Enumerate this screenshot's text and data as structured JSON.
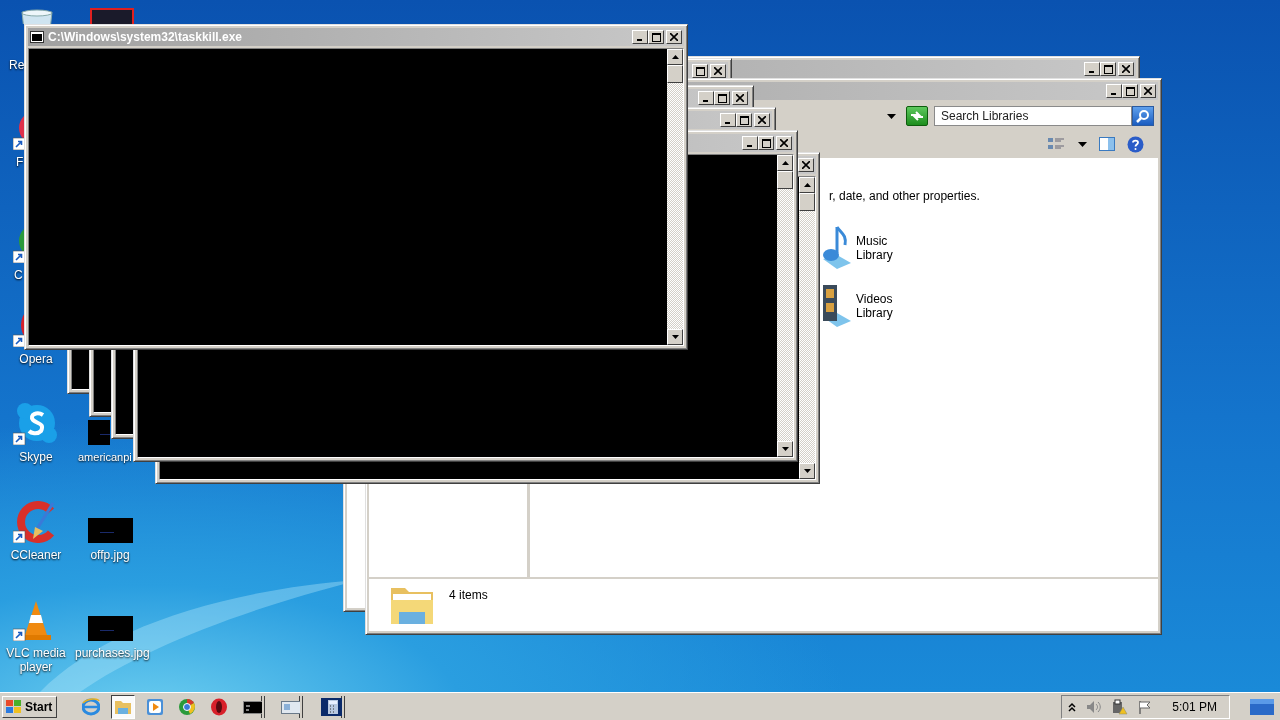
{
  "desktop_icons": [
    {
      "kind": "recycle-bin",
      "label": "Re",
      "shortcut": false
    },
    {
      "kind": "red-orb",
      "label": "F",
      "shortcut": true
    },
    {
      "kind": "color-orb",
      "label": "C",
      "shortcut": true
    },
    {
      "kind": "opera",
      "label": "Opera",
      "shortcut": true
    },
    {
      "kind": "skype",
      "label": "Skype",
      "shortcut": true
    },
    {
      "kind": "image",
      "label": "americanpi",
      "shortcut": false
    },
    {
      "kind": "ccleaner",
      "label": "CCleaner",
      "shortcut": true
    },
    {
      "kind": "image",
      "label": "offp.jpg",
      "shortcut": false
    },
    {
      "kind": "vlc",
      "label": "VLC media player",
      "shortcut": true
    },
    {
      "kind": "image",
      "label": "purchases.jpg",
      "shortcut": false
    }
  ],
  "explorer": {
    "search_placeholder": "Search Libraries",
    "description": "r, date, and other properties.",
    "libraries": [
      {
        "kind": "music",
        "name": "Music Library"
      },
      {
        "kind": "videos",
        "name": "Videos Library"
      }
    ],
    "status": "4 items"
  },
  "console": {
    "title": "C:\\Windows\\system32\\taskkill.exe"
  },
  "taskbar": {
    "start": "Start",
    "items": [
      {
        "kind": "ie",
        "selected": false,
        "grouped": false
      },
      {
        "kind": "folder",
        "selected": true,
        "grouped": false
      },
      {
        "kind": "media",
        "selected": false,
        "grouped": false
      },
      {
        "kind": "chrome",
        "selected": false,
        "grouped": false
      },
      {
        "kind": "opera",
        "selected": false,
        "grouped": false
      },
      {
        "kind": "console",
        "selected": false,
        "grouped": true
      },
      {
        "kind": "window",
        "selected": false,
        "grouped": true
      },
      {
        "kind": "calculator",
        "selected": false,
        "grouped": true
      }
    ],
    "clock": "5:01 PM"
  }
}
